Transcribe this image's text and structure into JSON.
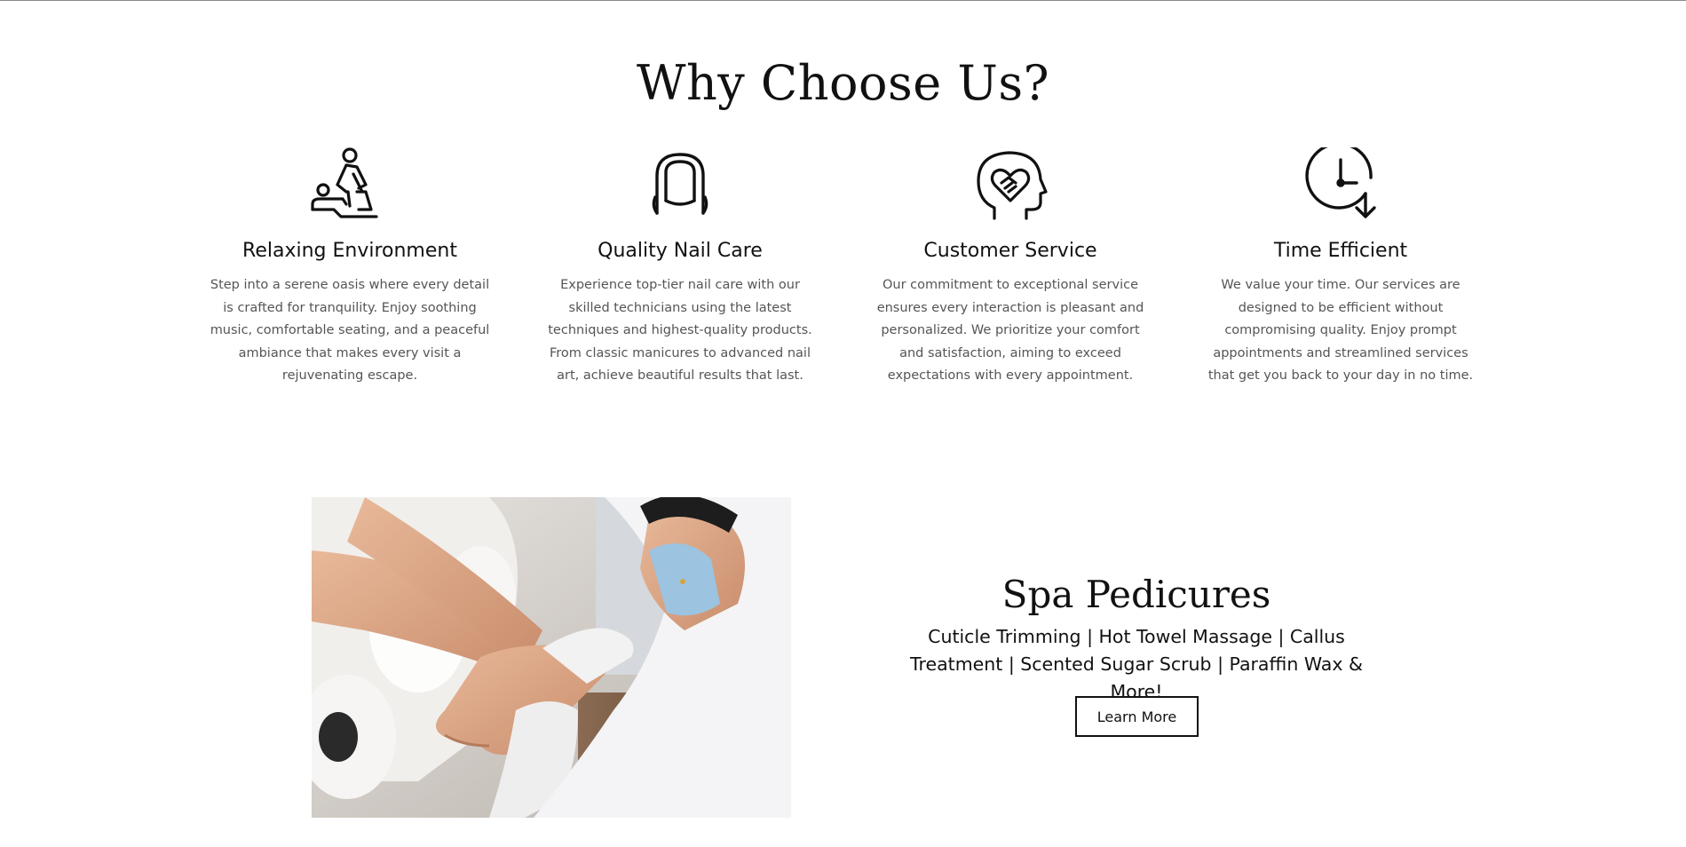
{
  "section": {
    "title": "Why Choose Us?"
  },
  "features": [
    {
      "icon": "massage-icon",
      "title": "Relaxing Environment",
      "description": "Step into a serene oasis where every detail is crafted for tranquility. Enjoy soothing music, comfortable seating, and a peaceful ambiance that makes every visit a rejuvenating escape."
    },
    {
      "icon": "nail-icon",
      "title": "Quality Nail Care",
      "description": "Experience top-tier nail care with our skilled technicians using the latest techniques and highest-quality products. From classic manicures to advanced nail art, achieve beautiful results that last."
    },
    {
      "icon": "heart-handshake-head-icon",
      "title": "Customer Service",
      "description": "Our commitment to exceptional service ensures every interaction is pleasant and personalized. We prioritize your comfort and satisfaction, aiming to exceed expectations with every appointment."
    },
    {
      "icon": "clock-arrow-icon",
      "title": "Time Efficient",
      "description": "We value your time. Our services are designed to be efficient without compromising quality. Enjoy prompt appointments and streamlined services that get you back to your day in no time."
    }
  ],
  "spa": {
    "title": "Spa Pedicures",
    "services": "Cuticle Trimming | Hot Towel Massage | Callus Treatment | Scented Sugar Scrub | Paraffin Wax & More!",
    "button_label": "Learn More",
    "photo_icon": "pedicure-photo"
  },
  "colors": {
    "text": "#111111",
    "muted_text": "#555555",
    "background": "#ffffff"
  }
}
